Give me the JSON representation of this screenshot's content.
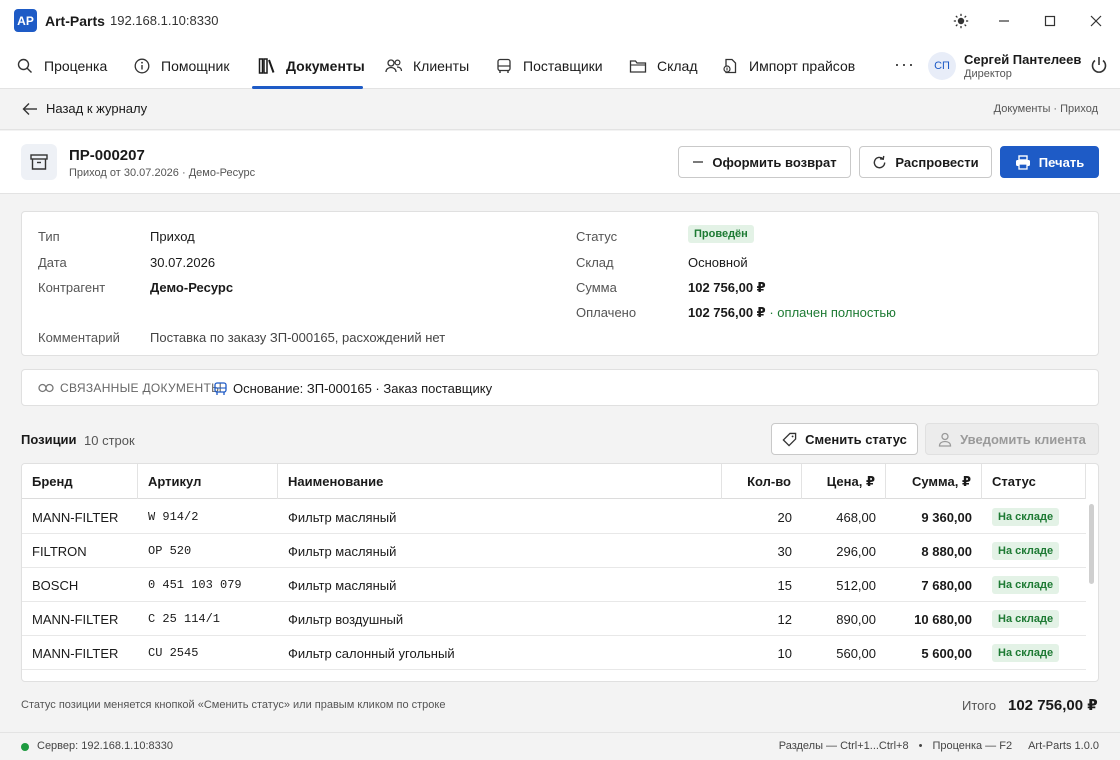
{
  "app": {
    "logo": "AP",
    "name": "Art-Parts",
    "host": "192.168.1.10:8330"
  },
  "nav": {
    "items": [
      {
        "label": "Проценка",
        "icon": "search-icon"
      },
      {
        "label": "Помощник",
        "icon": "info-icon"
      },
      {
        "label": "Документы",
        "icon": "books-icon",
        "active": true
      },
      {
        "label": "Клиенты",
        "icon": "users-icon"
      },
      {
        "label": "Поставщики",
        "icon": "bus-icon"
      },
      {
        "label": "Склад",
        "icon": "folder-icon"
      },
      {
        "label": "Импорт прайсов",
        "icon": "file-import-icon"
      }
    ],
    "more": "···"
  },
  "user": {
    "initials": "СП",
    "name": "Сергей Пантелеев",
    "role": "Директор"
  },
  "breadcrumb": {
    "back": "Назад к журналу",
    "path": "Документы · Приход"
  },
  "document": {
    "number": "ПР-000207",
    "subtitle": "Приход от 30.07.2026 · Демо-Ресурс",
    "actions": {
      "return": "Оформить возврат",
      "repost": "Распровести",
      "print": "Печать"
    }
  },
  "info": {
    "type_label": "Тип",
    "type": "Приход",
    "date_label": "Дата",
    "date": "30.07.2026",
    "counterparty_label": "Контрагент",
    "counterparty": "Демо-Ресурс",
    "comment_label": "Комментарий",
    "comment": "Поставка по заказу ЗП-000165, расхождений нет",
    "status_label": "Статус",
    "status": "Проведён",
    "warehouse_label": "Склад",
    "warehouse": "Основной",
    "sum_label": "Сумма",
    "sum": "102 756,00 ₽",
    "paid_label": "Оплачено",
    "paid": "102 756,00 ₽",
    "paid_note": "· оплачен полностью"
  },
  "related": {
    "label": "СВЯЗАННЫЕ ДОКУМЕНТЫ",
    "value": "Основание: ЗП-000165 · Заказ поставщику"
  },
  "positions": {
    "title": "Позиции",
    "count": "10 строк",
    "change_status": "Сменить статус",
    "notify_client": "Уведомить клиента",
    "columns": [
      "Бренд",
      "Артикул",
      "Наименование",
      "Кол-во",
      "Цена, ₽",
      "Сумма, ₽",
      "Статус"
    ],
    "rows": [
      {
        "brand": "MANN-FILTER",
        "article": "W 914/2",
        "name": "Фильтр масляный",
        "qty": "20",
        "price": "468,00",
        "sum": "9 360,00",
        "status": "На складе"
      },
      {
        "brand": "FILTRON",
        "article": "OP 520",
        "name": "Фильтр масляный",
        "qty": "30",
        "price": "296,00",
        "sum": "8 880,00",
        "status": "На складе"
      },
      {
        "brand": "BOSCH",
        "article": "0 451 103 079",
        "name": "Фильтр масляный",
        "qty": "15",
        "price": "512,00",
        "sum": "7 680,00",
        "status": "На складе"
      },
      {
        "brand": "MANN-FILTER",
        "article": "C 25 114/1",
        "name": "Фильтр воздушный",
        "qty": "12",
        "price": "890,00",
        "sum": "10 680,00",
        "status": "На складе"
      },
      {
        "brand": "MANN-FILTER",
        "article": "CU 2545",
        "name": "Фильтр салонный угольный",
        "qty": "10",
        "price": "560,00",
        "sum": "5 600,00",
        "status": "На складе"
      }
    ],
    "hint": "Статус позиции меняется кнопкой «Сменить статус» или правым кликом по строке",
    "total_label": "Итого",
    "total": "102 756,00 ₽"
  },
  "statusbar": {
    "server": "Сервер: 192.168.1.10:8330",
    "sections": "Разделы — Ctrl+1...Ctrl+8",
    "sep": "•",
    "pricing": "Проценка — F2",
    "version": "Art-Parts 1.0.0"
  },
  "colors": {
    "accent": "#1e5bc6",
    "success": "#1d7a33",
    "success_bg": "#e3f2e6"
  }
}
